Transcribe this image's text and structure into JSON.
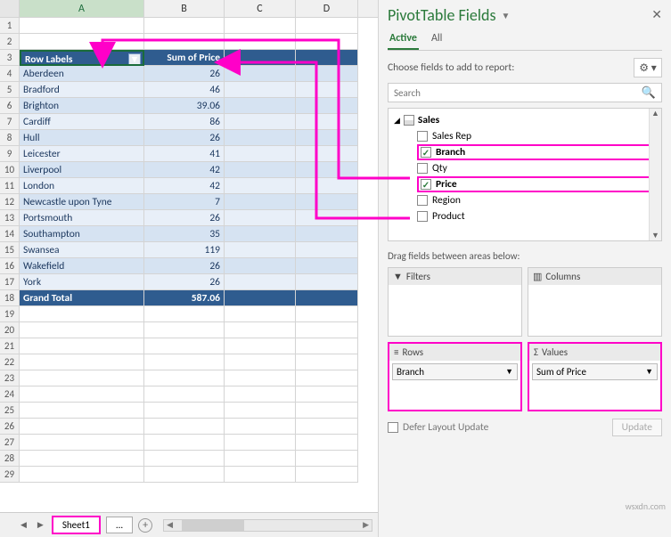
{
  "columns": [
    "A",
    "B",
    "C",
    "D"
  ],
  "pivot_headers": {
    "a": "Row Labels",
    "b": "Sum of Price"
  },
  "pivot_rows": [
    {
      "label": "Aberdeen",
      "value": "26"
    },
    {
      "label": "Bradford",
      "value": "46"
    },
    {
      "label": "Brighton",
      "value": "39.06"
    },
    {
      "label": "Cardiff",
      "value": "86"
    },
    {
      "label": "Hull",
      "value": "26"
    },
    {
      "label": "Leicester",
      "value": "41"
    },
    {
      "label": "Liverpool",
      "value": "42"
    },
    {
      "label": "London",
      "value": "42"
    },
    {
      "label": "Newcastle upon Tyne",
      "value": "7"
    },
    {
      "label": "Portsmouth",
      "value": "26"
    },
    {
      "label": "Southampton",
      "value": "35"
    },
    {
      "label": "Swansea",
      "value": "119"
    },
    {
      "label": "Wakefield",
      "value": "26"
    },
    {
      "label": "York",
      "value": "26"
    }
  ],
  "grand_total": {
    "label": "Grand Total",
    "value": "587.06"
  },
  "row_start": 3,
  "empty_rows_after": 10,
  "sheet_tabs": {
    "active": "Sheet1",
    "more": "..."
  },
  "pane": {
    "title": "PivotTable Fields",
    "tabs": {
      "active": "Active",
      "all": "All"
    },
    "choose": "Choose fields to add to report:",
    "search_placeholder": "Search",
    "table": "Sales",
    "fields": [
      {
        "name": "Sales Rep",
        "checked": false,
        "boxed": false
      },
      {
        "name": "Branch",
        "checked": true,
        "boxed": true
      },
      {
        "name": "Qty",
        "checked": false,
        "boxed": false
      },
      {
        "name": "Price",
        "checked": true,
        "boxed": true
      },
      {
        "name": "Region",
        "checked": false,
        "boxed": false
      },
      {
        "name": "Product",
        "checked": false,
        "boxed": false
      }
    ],
    "drag_label": "Drag fields between areas below:",
    "areas": {
      "filters": "Filters",
      "columns": "Columns",
      "rows": "Rows",
      "values": "Values",
      "rows_chip": "Branch",
      "values_chip": "Sum of Price"
    },
    "defer": "Defer Layout Update",
    "update": "Update"
  },
  "watermark": "wsxdn.com"
}
